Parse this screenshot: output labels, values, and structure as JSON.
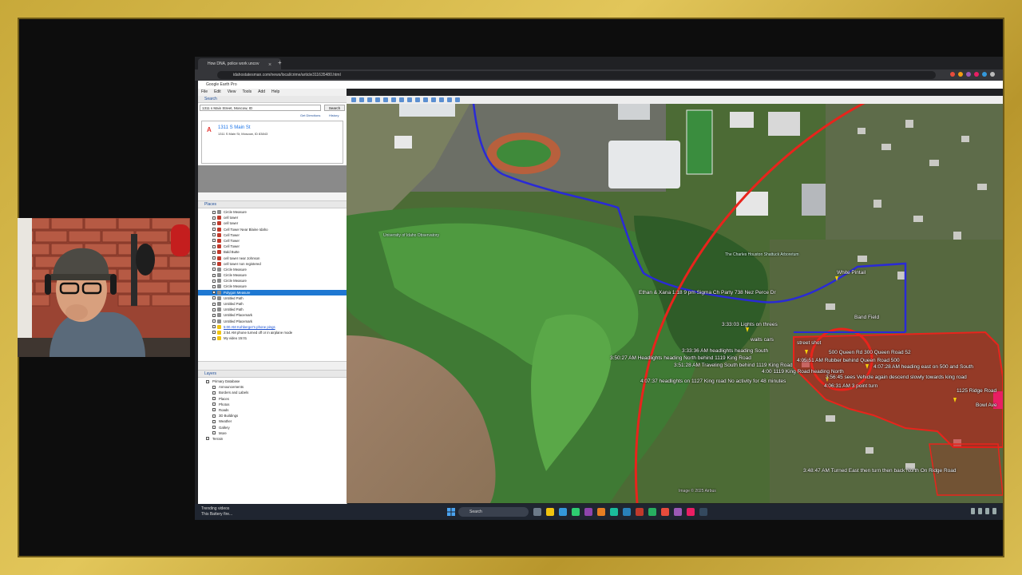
{
  "browser": {
    "tab_title": "How DNA, police work uncov",
    "tab_close": "×",
    "new_tab": "+",
    "url": "idahostatesman.com/news/local/crime/article311635480.html"
  },
  "google_earth": {
    "window_title": "Google Earth Pro",
    "menu": [
      "File",
      "Edit",
      "View",
      "Tools",
      "Add",
      "Help"
    ],
    "search_section": "Search",
    "search_value": "1311 s Main Street, Moscow, ID",
    "search_button": "Search",
    "get_directions": "Get Directions",
    "history": "History",
    "result_pin": "A",
    "result_title": "1311 S Main St",
    "result_address": "1311 S Main St, Moscow, ID 83843",
    "places_section": "Places",
    "places": [
      {
        "label": "Circle Measure",
        "icon": "circle-measure-icon",
        "color": "#8a8a8a"
      },
      {
        "label": "cell tower",
        "icon": "cell-tower-icon",
        "color": "#c0392b"
      },
      {
        "label": "cell tower",
        "icon": "cell-tower-icon",
        "color": "#c0392b"
      },
      {
        "label": "Cell Tower Near Blaine Idaho",
        "icon": "cell-tower-icon",
        "color": "#c0392b"
      },
      {
        "label": "Cell Tower",
        "icon": "cell-tower-icon",
        "color": "#c0392b"
      },
      {
        "label": "Cell Tower",
        "icon": "cell-tower-icon",
        "color": "#c0392b"
      },
      {
        "label": "Cell Tower",
        "icon": "cell-tower-icon",
        "color": "#c0392b"
      },
      {
        "label": "Bald Butte",
        "icon": "cell-tower-icon",
        "color": "#c0392b"
      },
      {
        "label": "cell tower near Johnson",
        "icon": "cell-tower-icon",
        "color": "#c0392b"
      },
      {
        "label": "cell tower non registered",
        "icon": "cell-tower-icon",
        "color": "#c0392b"
      },
      {
        "label": "Circle Measure",
        "icon": "circle-measure-icon",
        "color": "#8a8a8a"
      },
      {
        "label": "Circle Measure",
        "icon": "circle-measure-icon",
        "color": "#8a8a8a"
      },
      {
        "label": "Circle Measure",
        "icon": "circle-measure-icon",
        "color": "#8a8a8a"
      },
      {
        "label": "Circle Measure",
        "icon": "circle-measure-icon",
        "color": "#8a8a8a"
      },
      {
        "label": "Polygon Measure",
        "icon": "polygon-measure-icon",
        "color": "#8a8a8a",
        "selected": true
      },
      {
        "label": "Untitled Path",
        "icon": "path-icon",
        "color": "#8a8a8a"
      },
      {
        "label": "Untitled Path",
        "icon": "path-icon",
        "color": "#8a8a8a"
      },
      {
        "label": "Untitled Path",
        "icon": "path-icon",
        "color": "#8a8a8a"
      },
      {
        "label": "Untitled Placemark",
        "icon": "placemark-icon",
        "color": "#8a8a8a"
      },
      {
        "label": "Untitled Placemark",
        "icon": "placemark-icon",
        "color": "#8a8a8a"
      },
      {
        "label": "5:00 AM Kohberger's phone pings",
        "icon": "placemark-icon",
        "color": "#f1c40f",
        "link": true
      },
      {
        "label": "2:54 AM phone turned off or in airplane mode",
        "icon": "placemark-icon",
        "color": "#f1c40f"
      },
      {
        "label": "My video 15:01",
        "icon": "placemark-icon",
        "color": "#f1c40f"
      }
    ],
    "layers_section": "Layers",
    "layers": [
      {
        "label": "Primary Database",
        "indent": 10
      },
      {
        "label": "Announcements",
        "indent": 18
      },
      {
        "label": "Borders and Labels",
        "indent": 18
      },
      {
        "label": "Places",
        "indent": 18
      },
      {
        "label": "Photos",
        "indent": 18
      },
      {
        "label": "Roads",
        "indent": 18
      },
      {
        "label": "3D Buildings",
        "indent": 18
      },
      {
        "label": "Weather",
        "indent": 18
      },
      {
        "label": "Gallery",
        "indent": 18
      },
      {
        "label": "More",
        "indent": 18
      },
      {
        "label": "Terrain",
        "indent": 10
      }
    ]
  },
  "map_labels": {
    "observatory": "University of Idaho Observatory",
    "arboretum": "The Charles Houston Shattuck Arboretum",
    "label_white_pintail": "White Pintail",
    "label_band_field": "Band Field",
    "label_ethan": "Ethan & Xana 1:18 9 pm Sigma Ch Party 738 Nez Perce Dr",
    "label_lights": "3:33:03 Lights on threes",
    "label_waits": "waits cars",
    "label_street": "street shot",
    "label_headlights_north": "3:33:36 AM headlights heading South",
    "label_queen": "500 Queen Rd 300 Queen Road 52",
    "label_heading_north_king": "3:50:27 AM Headlights heading North behind 1119 King Road",
    "label_behind_queen": "4:05:51 AM Rubber behind Queen Road 500",
    "label_traveling": "3:51:28 AM Traveling South behind 1119 King Road",
    "label_heading_east": "4:07:28 AM heading east on 500 and South",
    "label_king_rd": "4:00 1119 King Road heading North",
    "label_vehicle": "3:56:45 sees Vehicle again descend slowly towards king road",
    "label_activity": "4:07:37 headlights on 1127 King road No activity for 48 minutes",
    "label_3point": "4:06:31 AM 3 point turn",
    "label_ridge": "1125 Ridge Road",
    "label_bowl": "Bowl Ave",
    "label_turned": "3:48:47 AM Turned East then turn then back North On Ridge Road",
    "credit": "Image © 2025 Airbus"
  },
  "taskbar": {
    "news_line1": "Trending videos",
    "news_line2": "This Battery fire...",
    "search_placeholder": "Search"
  },
  "colors": {
    "frame_gold": "#d9bd52",
    "boundary_red": "#e8241c",
    "route_blue": "#2a2ad6",
    "selection_blue": "#1e78d2"
  }
}
